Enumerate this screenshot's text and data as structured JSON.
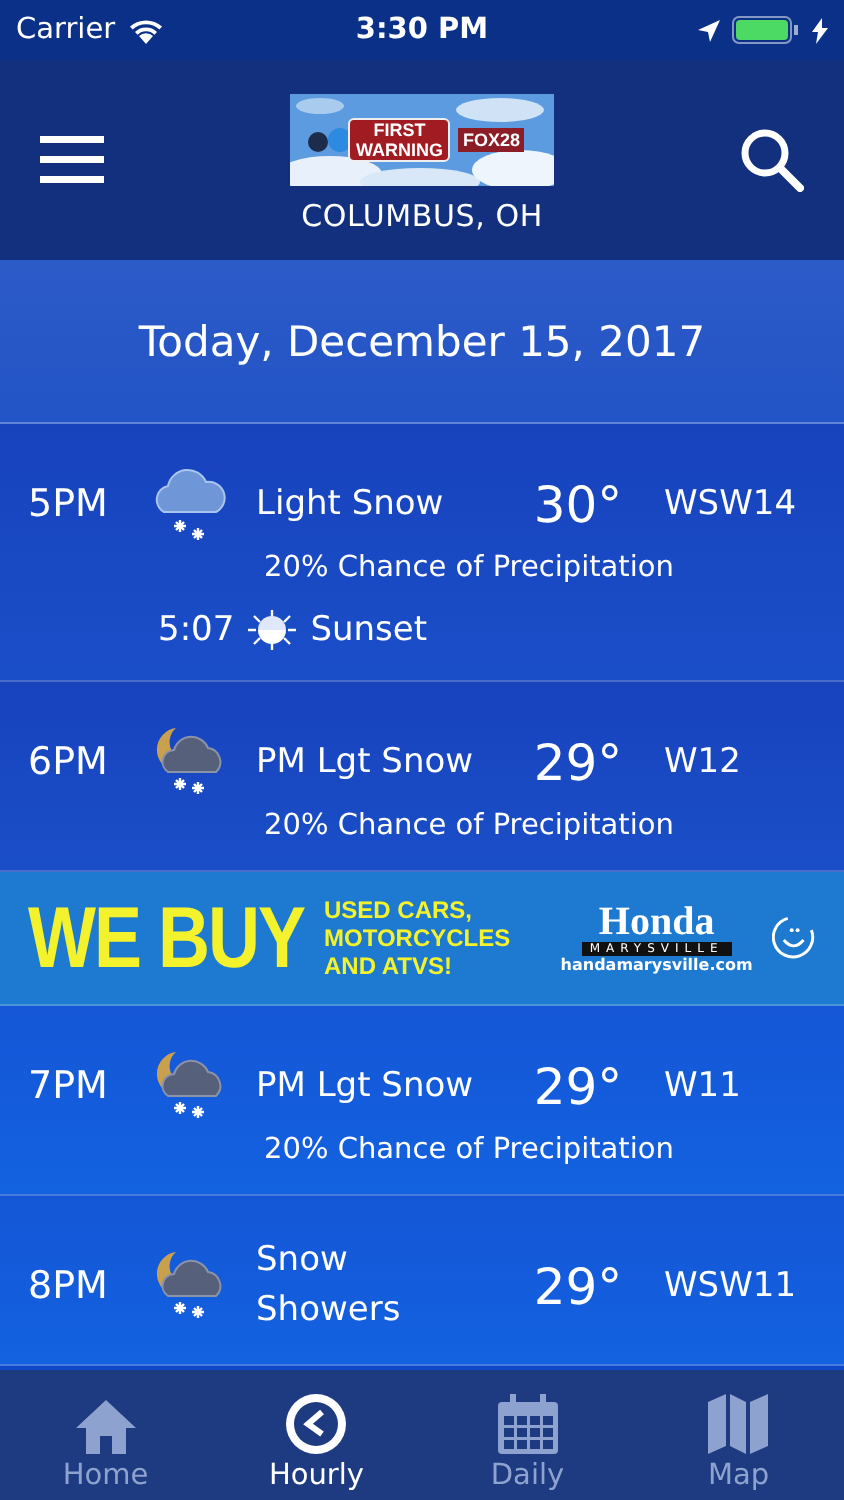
{
  "status_bar": {
    "carrier": "Carrier",
    "time": "3:30 PM"
  },
  "header": {
    "logo": {
      "line_1": "FIRST",
      "line_2": "WARNING",
      "badge": "FOX28"
    },
    "location": "COLUMBUS, OH"
  },
  "date": "Today, December 15, 2017",
  "hours": [
    {
      "kind": "forecast",
      "time": "5PM",
      "condition": "Light Snow",
      "temp": "30°",
      "wind": "WSW14",
      "precip": "20% Chance of Precipitation",
      "event": {
        "time": "5:07",
        "label": "Sunset"
      }
    },
    {
      "kind": "forecast",
      "time": "6PM",
      "condition": "PM Lgt Snow",
      "temp": "29°",
      "wind": "W12",
      "precip": "20% Chance of Precipitation"
    },
    {
      "kind": "ad",
      "big": "WE BUY",
      "lines": "USED CARS, MOTORCYCLES AND ATVS!",
      "brand": "Honda",
      "brand_sub": "MARYSVILLE",
      "url": "handamarysville.com"
    },
    {
      "kind": "forecast",
      "time": "7PM",
      "condition": "PM Lgt Snow",
      "temp": "29°",
      "wind": "W11",
      "precip": "20% Chance of Precipitation"
    },
    {
      "kind": "forecast",
      "time": "8PM",
      "condition": "Snow Showers",
      "temp": "29°",
      "wind": "WSW11"
    }
  ],
  "tabs": [
    {
      "label": "Home",
      "selected": false
    },
    {
      "label": "Hourly",
      "selected": true
    },
    {
      "label": "Daily",
      "selected": false
    },
    {
      "label": "Map",
      "selected": false
    }
  ]
}
